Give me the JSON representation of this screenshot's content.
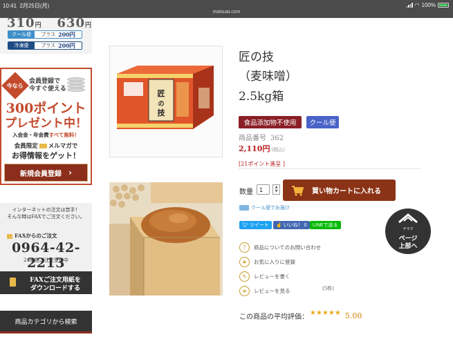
{
  "status_bar": {
    "time": "10:41",
    "date": "2月25日(月)",
    "url": "matsuai.com",
    "battery": "100%"
  },
  "sidebar": {
    "shipping": {
      "price_fragment": "310",
      "price_yen": "円",
      "price_fragment2": "630",
      "cool_label": "クール便",
      "frozen_label": "冷凍便",
      "plus_label": "プラス",
      "plus_amount": "200円"
    },
    "promo": {
      "badge": "今なら",
      "line1": "会員登録で",
      "line2": "今すぐ使える",
      "big1": "300ポイント",
      "big2": "プレゼント中！",
      "note_prefix": "入会金・年会費",
      "note_highlight": "すべて無料！",
      "member_line_prefix": "会員限定",
      "member_line_suffix": "メルマガで",
      "member_line2": "お得情報をゲット！",
      "register_button": "新規会員登録"
    },
    "fax": {
      "intro1": "インターネットの注文は苦手！",
      "intro2": "そんな時はFAXでご注文ください。",
      "fax_heading": "FAXからのご注文",
      "fax_number": "0964-42-2213",
      "hours": "24時間ご注文受付中",
      "download_line1": "FAXご注文用紙を",
      "download_line2": "ダウンロードする"
    },
    "category_search": "商品カテゴリから検索"
  },
  "product": {
    "title_line1": "匠の技",
    "title_line2": "（麦味噌）",
    "title_line3": "2.5kg箱",
    "badge_additive_free": "食品添加物不使用",
    "badge_cool": "クール便",
    "number_label": "商品番号",
    "number_value": "362",
    "price": "2,110円",
    "tax_note": "(税込)",
    "points": "[21ポイント進呈 ]",
    "box_label": "匠の技"
  },
  "purchase": {
    "quantity_label": "数量",
    "quantity_value": "1",
    "add_to_cart": "買い物カートに入れる",
    "cool_delivery_link": "クール便でお届け"
  },
  "social": {
    "tweet": "ツイート",
    "like": "いいね！ 0",
    "line": "LINEで送る"
  },
  "actions": {
    "inquiry": "商品についてのお問い合わせ",
    "favorite": "お気に入りに登録",
    "write_review": "レビューを書く",
    "view_reviews": "レビューを見る",
    "review_count": "(5件)"
  },
  "rating": {
    "label": "この商品の平均評価：",
    "stars": "★★★★★",
    "value": "5.00"
  },
  "page_top": {
    "brand": "ヤママ",
    "line1": "ページ",
    "line2": "上部へ"
  }
}
